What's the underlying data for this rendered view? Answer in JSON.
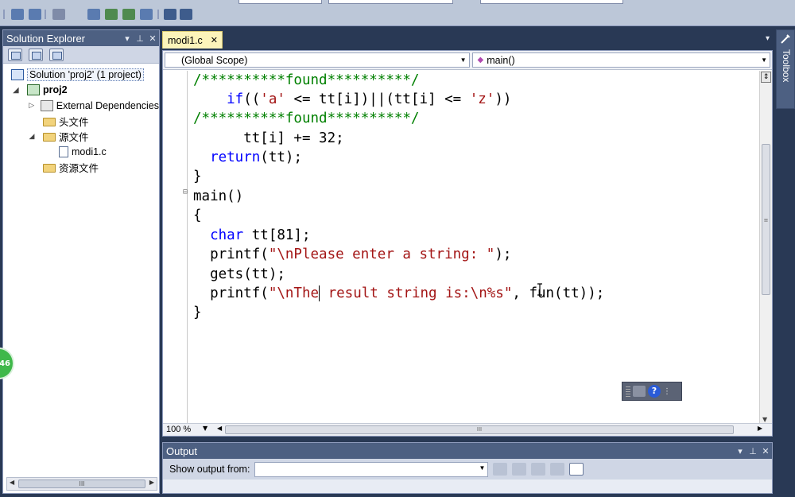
{
  "solution_explorer": {
    "title": "Solution Explorer",
    "tree": [
      {
        "label": "Solution 'proj2' (1 project)",
        "icon": "solution-icon"
      },
      {
        "label": "proj2",
        "icon": "project-icon"
      },
      {
        "label": "External Dependencies",
        "icon": "dependencies-icon"
      },
      {
        "label": "头文件",
        "icon": "folder-icon"
      },
      {
        "label": "源文件",
        "icon": "folder-open-icon"
      },
      {
        "label": "modi1.c",
        "icon": "c-file-icon"
      },
      {
        "label": "资源文件",
        "icon": "folder-icon"
      }
    ]
  },
  "editor": {
    "tab_label": "modi1.c",
    "scope_combo": "(Global Scope)",
    "member_combo": "main()",
    "zoom": "100 %"
  },
  "code_lines": [
    {
      "text": "/**********found**********/"
    },
    {
      "text": "    if(('a' <= tt[i])||(tt[i] <= 'z'))"
    },
    {
      "text": "/**********found**********/"
    },
    {
      "text": "      tt[i] += 32;"
    },
    {
      "text": "  return(tt);"
    },
    {
      "text": "}"
    },
    {
      "text": "main()"
    },
    {
      "text": "{"
    },
    {
      "text": "  char tt[81];"
    },
    {
      "text": "  printf(\"\\nPlease enter a string: \");"
    },
    {
      "text": "  gets(tt);"
    },
    {
      "text": "  printf(\"\\nThe result string is:\\n%s\", fun(tt));"
    },
    {
      "text": "}"
    }
  ],
  "output": {
    "title": "Output",
    "show_output_label": "Show output from:",
    "source_value": ""
  },
  "toolbox": {
    "label": "Toolbox"
  },
  "badge": {
    "text": "46"
  },
  "colors": {
    "panel_header": "#4d6082",
    "background": "#293955",
    "tab_active": "#fcf4ba",
    "keyword": "#0000ff",
    "comment": "#008000",
    "string": "#a31515"
  }
}
